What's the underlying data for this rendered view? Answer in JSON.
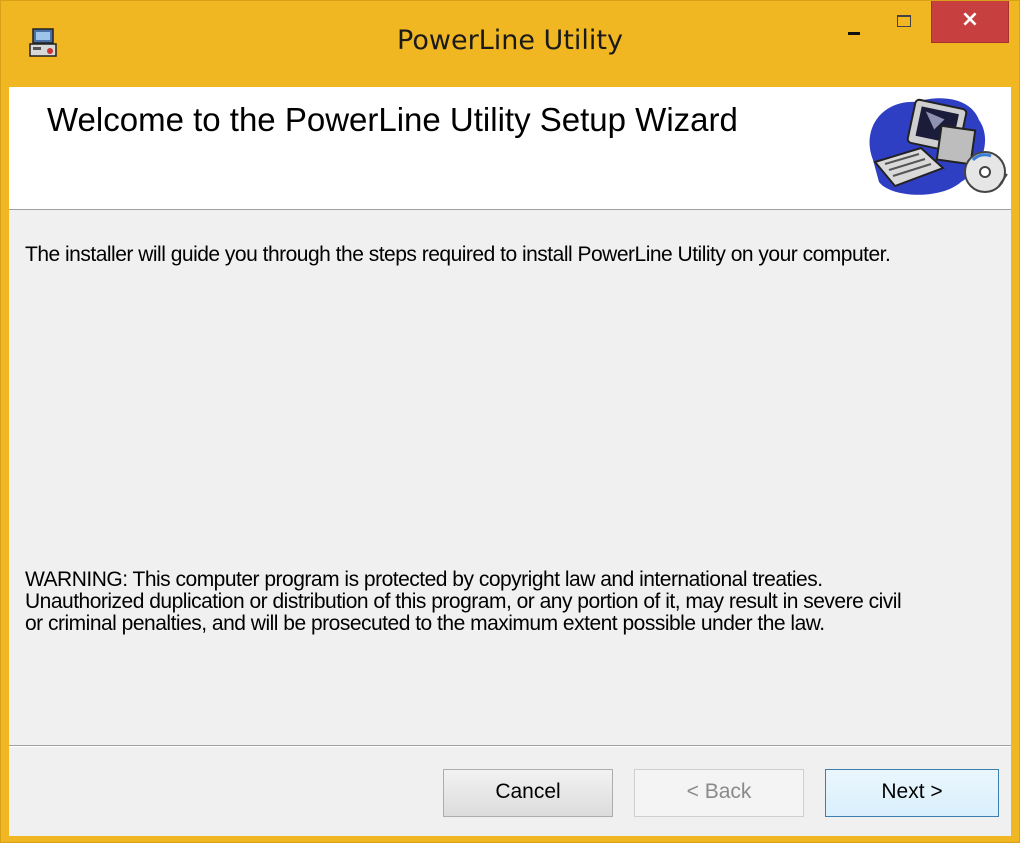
{
  "window": {
    "title": "PowerLine Utility",
    "close_glyph": "×"
  },
  "banner": {
    "title": "Welcome to the PowerLine Utility Setup Wizard",
    "image": "computer-with-disc-icon"
  },
  "content": {
    "intro": "The installer will guide you through the steps required to install PowerLine Utility on your computer.",
    "warning_lines": [
      "WARNING: This computer program is protected by copyright law and international treaties.",
      "Unauthorized duplication or distribution of this program, or any portion of it, may result in severe civil",
      "or criminal penalties, and will be prosecuted to the maximum extent possible under the law."
    ]
  },
  "buttons": {
    "cancel": "Cancel",
    "back": "< Back",
    "next": "Next >"
  },
  "colors": {
    "titlebar": "#f0b722",
    "close_button": "#c7403f",
    "dialog_background": "#f0f0f0",
    "default_button_border": "#3c7fb1"
  }
}
